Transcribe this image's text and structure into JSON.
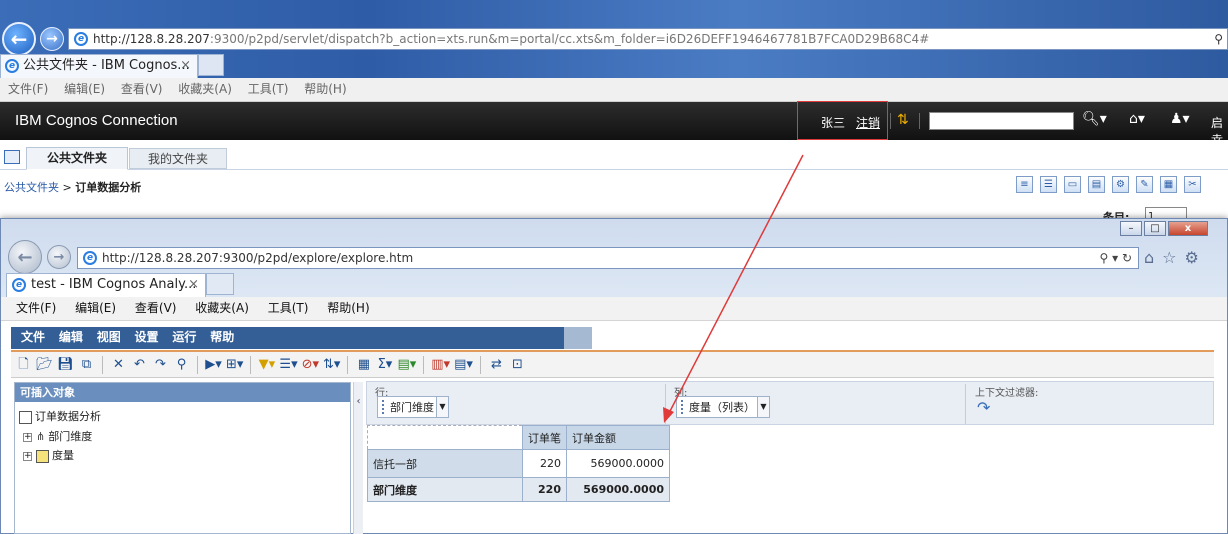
{
  "back_browser": {
    "address_host": "http://128.8.28.207",
    "address_rest": ":9300/p2pd/servlet/dispatch?b_action=xts.run&m=portal/cc.xts&m_folder=i6D26DEFF1946467781B7FCA0D29B68C4#",
    "tab_title": "公共文件夹 - IBM Cognos...",
    "menu": [
      "文件(F)",
      "编辑(E)",
      "查看(V)",
      "收藏夹(A)",
      "工具(T)",
      "帮助(H)"
    ]
  },
  "cognos_connection": {
    "title": "IBM Cognos Connection",
    "user_name": "张三",
    "logout_label": "注销",
    "right_edge_text": "启幸",
    "tabs": [
      "公共文件夹",
      "我的文件夹"
    ],
    "breadcrumb_root": "公共文件夹",
    "breadcrumb_sep": ">",
    "breadcrumb_current": "订单数据分析",
    "page_label": "条目:",
    "page_value": "1"
  },
  "front_browser": {
    "address": "http://128.8.28.207:9300/p2pd/explore/explore.htm",
    "tab_title": "test - IBM Cognos Analy...",
    "menu": [
      "文件(F)",
      "编辑(E)",
      "查看(V)",
      "收藏夹(A)",
      "工具(T)",
      "帮助(H)"
    ],
    "window_controls": [
      "–",
      "□",
      "x"
    ]
  },
  "analysis_studio": {
    "menu": [
      "文件",
      "编辑",
      "视图",
      "设置",
      "运行",
      "帮助"
    ],
    "insertable_header": "可插入对象",
    "tree_root": "订单数据分析",
    "tree_items": [
      "部门维度",
      "度量"
    ],
    "rows_label": "行:",
    "rows_chip": "部门维度",
    "cols_label": "列:",
    "cols_chip": "度量（列表）",
    "filter_label": "上下文过滤器:",
    "grid": {
      "col_headers": [
        "订单笔",
        "订单金额"
      ],
      "rows": [
        {
          "label": "信托一部",
          "count": "220",
          "amount": "569000.0000"
        }
      ],
      "total": {
        "label": "部门维度",
        "count": "220",
        "amount": "569000.0000"
      }
    }
  },
  "colors": {
    "annotation_red": "#e03a3a",
    "cognos_bar": "#1c1c1c",
    "analysis_menu_blue": "#335f96",
    "toolbar_orange": "#e29b5b"
  }
}
